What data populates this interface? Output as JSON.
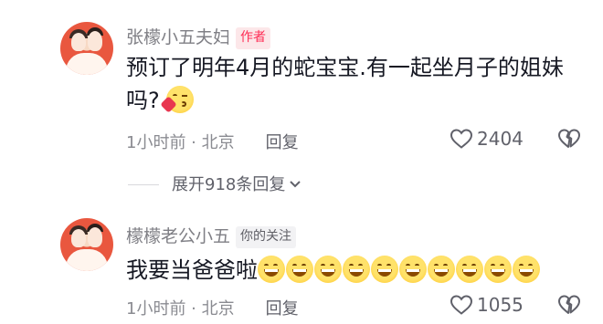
{
  "comments": [
    {
      "author": "张檬小五夫妇",
      "badge": "作者",
      "text": "预订了明年4月的蛇宝宝.有一起坐月子的姐妹吗?",
      "emoji": "kiss-emoji",
      "time_location": "1小时前 · 北京",
      "reply_label": "回复",
      "likes": "2404",
      "expand_replies": "展开918条回复"
    },
    {
      "author": "檬檬老公小五",
      "badge": "你的关注",
      "text": "我要当爸爸啦",
      "emoji": "grinning-emoji",
      "emoji_count": 10,
      "time_location": "1小时前 · 北京",
      "reply_label": "回复",
      "likes": "1055"
    }
  ],
  "colors": {
    "author_badge_bg": "#fce7e9",
    "author_badge_text": "#fe2c55",
    "follow_badge_bg": "#f2f2f4",
    "name_text": "#7f7f85",
    "meta_text": "#8a8b91"
  },
  "icons": [
    "avatar",
    "heart-outline-icon",
    "broken-heart-icon",
    "chevron-down-icon"
  ]
}
